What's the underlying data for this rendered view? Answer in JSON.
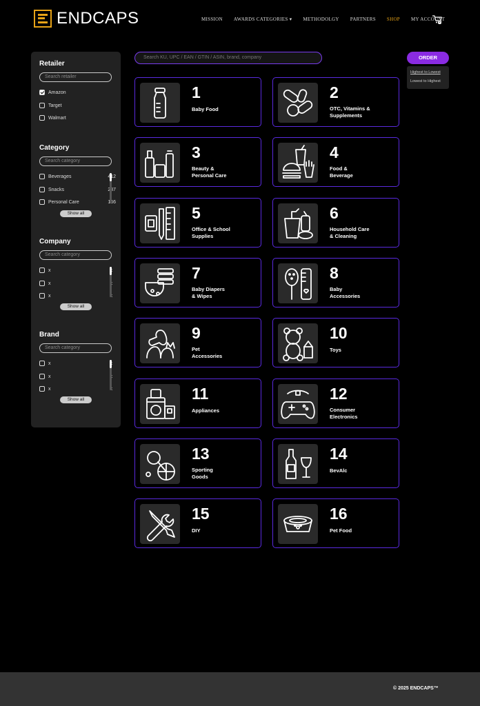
{
  "brand": {
    "name": "ENDCAPS"
  },
  "nav": [
    {
      "label": "MISSION"
    },
    {
      "label": "AWARDS CATEGORIES ▾"
    },
    {
      "label": "METHODOLGY"
    },
    {
      "label": "PARTNERS"
    },
    {
      "label": "SHOP"
    },
    {
      "label": "MY ACCOUNT"
    }
  ],
  "cart_count": "0",
  "sidebar": {
    "retailer": {
      "title": "Retailer",
      "placeholder": "Search retailer",
      "items": [
        {
          "label": "Amazon",
          "checked": true
        },
        {
          "label": "Target",
          "checked": false
        },
        {
          "label": "Walmart",
          "checked": false
        }
      ]
    },
    "category": {
      "title": "Category",
      "placeholder": "Search category",
      "items": [
        {
          "label": "Beverages",
          "count": "412"
        },
        {
          "label": "Snacks",
          "count": "287"
        },
        {
          "label": "Personal Care",
          "count": "166"
        }
      ],
      "show_all": "Show all"
    },
    "company": {
      "title": "Company",
      "placeholder": "Search category",
      "items": [
        {
          "label": "x",
          "count": "x"
        },
        {
          "label": "x",
          "count": "x"
        },
        {
          "label": "x",
          "count": "x"
        }
      ],
      "show_all": "Show all"
    },
    "brand": {
      "title": "Brand",
      "placeholder": "Search category",
      "items": [
        {
          "label": "x",
          "count": "x"
        },
        {
          "label": "x",
          "count": "x"
        },
        {
          "label": "x",
          "count": "x"
        }
      ],
      "show_all": "Show all"
    }
  },
  "search": {
    "placeholder": "Search KU, UPC / EAN / GTIN / ASIN, brand, company"
  },
  "order": {
    "label": "ORDER",
    "options": [
      "Highest to Lowest",
      "Lowest to Highest"
    ]
  },
  "categories": [
    {
      "num": "1",
      "label": "Baby Food",
      "icon": "baby-bottle-icon"
    },
    {
      "num": "2",
      "label": "OTC, Vitamins &\nSupplements",
      "icon": "pills-icon"
    },
    {
      "num": "3",
      "label": "Beauty &\nPersonal Care",
      "icon": "cosmetics-icon"
    },
    {
      "num": "4",
      "label": "Food &\nBeverage",
      "icon": "burger-drink-icon"
    },
    {
      "num": "5",
      "label": "Office & School\nSupplies",
      "icon": "pencil-ruler-icon"
    },
    {
      "num": "6",
      "label": "Household Care\n& Cleaning",
      "icon": "cleaning-bucket-icon"
    },
    {
      "num": "7",
      "label": "Baby Diapers\n& Wipes",
      "icon": "diaper-icon"
    },
    {
      "num": "8",
      "label": "Baby\nAccessories",
      "icon": "brush-comb-icon"
    },
    {
      "num": "9",
      "label": "Pet\nAccessories",
      "icon": "dog-cat-icon"
    },
    {
      "num": "10",
      "label": "Toys",
      "icon": "teddy-bear-icon"
    },
    {
      "num": "11",
      "label": "Appliances",
      "icon": "appliances-icon"
    },
    {
      "num": "12",
      "label": "Consumer\nElectronics",
      "icon": "game-controller-icon"
    },
    {
      "num": "13",
      "label": "Sporting\nGoods",
      "icon": "sports-ball-icon"
    },
    {
      "num": "14",
      "label": "BevAlc",
      "icon": "wine-bottle-icon"
    },
    {
      "num": "15",
      "label": "DIY",
      "icon": "wrench-screwdriver-icon"
    },
    {
      "num": "16",
      "label": "Pet Food",
      "icon": "pet-bowl-icon"
    }
  ],
  "footer": {
    "text": "© 2025 ENDCAPS™"
  }
}
